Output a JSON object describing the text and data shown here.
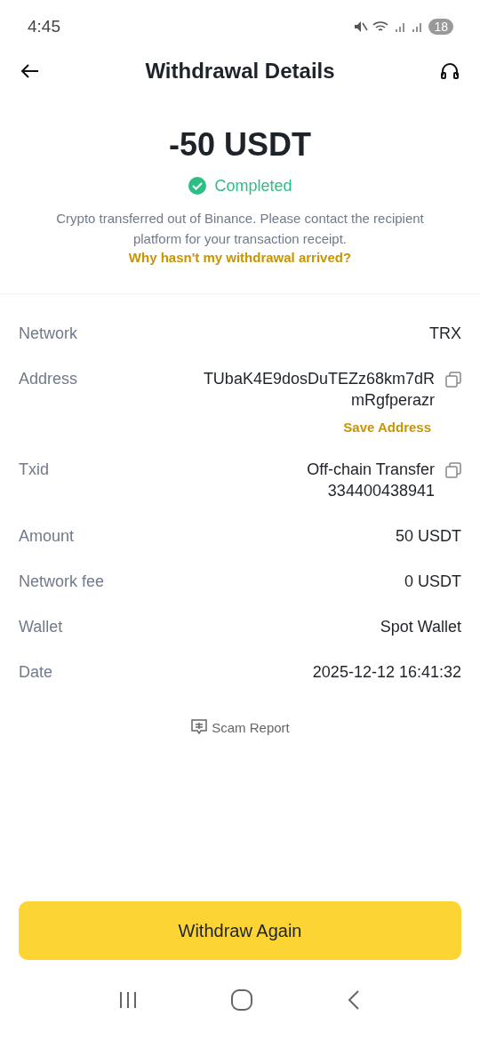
{
  "status_bar": {
    "time": "4:45",
    "battery": "18"
  },
  "header": {
    "title": "Withdrawal Details"
  },
  "summary": {
    "amount": "-50 USDT",
    "status": "Completed",
    "completed": true,
    "note": "Crypto transferred out of Binance. Please contact the recipient platform for your transaction receipt.",
    "link": "Why hasn't my withdrawal arrived?"
  },
  "details": [
    {
      "label": "Network",
      "value": [
        "TRX"
      ],
      "copy": false
    },
    {
      "label": "Address",
      "value": [
        "TUbaK4E9dosDuTEZz68km7dR",
        "mRgfperazr"
      ],
      "copy": true,
      "action": "Save Address"
    },
    {
      "label": "Txid",
      "value": [
        "Off-chain Transfer",
        "334400438941"
      ],
      "copy": true
    },
    {
      "label": "Amount",
      "value": [
        "50 USDT"
      ],
      "copy": false
    },
    {
      "label": "Network fee",
      "value": [
        "0 USDT"
      ],
      "copy": false
    },
    {
      "label": "Wallet",
      "value": [
        "Spot Wallet"
      ],
      "copy": false
    },
    {
      "label": "Date",
      "value": [
        "2025-12-12 16:41:32"
      ],
      "copy": false
    }
  ],
  "scam_report": "Scam Report",
  "primary_button": "Withdraw Again"
}
